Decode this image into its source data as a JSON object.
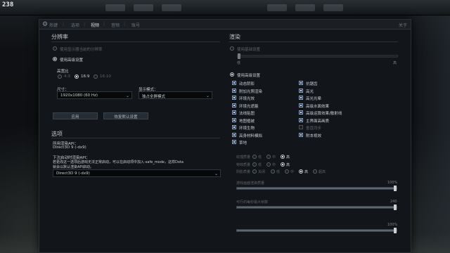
{
  "hud": {
    "fps": "238"
  },
  "tabs": [
    {
      "label": "热键"
    },
    {
      "label": "选项"
    },
    {
      "label": "视频"
    },
    {
      "label": "音频"
    },
    {
      "label": "账号"
    }
  ],
  "active_tab": "视频",
  "close_label": "关于",
  "resolution": {
    "title": "分辨率",
    "use_desktop_label": "使用显示器当前的分辨率",
    "use_advanced_label": "使用高级设置",
    "aspect_title": "高宽比",
    "aspect_options": [
      {
        "label": "4:3",
        "selected": false
      },
      {
        "label": "16:9",
        "selected": true
      },
      {
        "label": "16:10",
        "selected": false
      }
    ],
    "size_label": "尺寸：",
    "size_value": "1920x1080 (60 Hz)",
    "display_mode_label": "显示模式：",
    "display_mode_value": "独占全屏模式",
    "apply_button": "应用",
    "reset_button": "恢复默认设置"
  },
  "options": {
    "title": "选项",
    "api_label": "所用渲染API：",
    "api_value": "Direct3D 9 (-dx9)",
    "next_api_label": "下次启动时渲染API：",
    "warning_line1": "若更改这一选项后游戏无法正常启动，可以在启动项中加入-safe_mode，这样Dota",
    "warning_line2": "就会以默认渲染API启动。",
    "api_select_value": "Direct3D 9 (-dx9)"
  },
  "rendering": {
    "title": "渲染",
    "use_basic_label": "使用基础设置",
    "basic_slider_left": "低",
    "basic_slider_right": "高",
    "use_advanced_label": "使用高级设置",
    "checkboxes_left": [
      {
        "label": "动态阴影",
        "checked": true
      },
      {
        "label": "附加光照渲染",
        "checked": true
      },
      {
        "label": "环境光效",
        "checked": true
      },
      {
        "label": "环境光遮蔽",
        "checked": true
      },
      {
        "label": "法线贴图",
        "checked": true
      },
      {
        "label": "地图植被",
        "checked": true
      },
      {
        "label": "环境生物",
        "checked": true
      },
      {
        "label": "高身材料模拟",
        "checked": true
      },
      {
        "label": "草地",
        "checked": true
      }
    ],
    "checkboxes_right": [
      {
        "label": "抗锯齿",
        "checked": true
      },
      {
        "label": "高光",
        "checked": true
      },
      {
        "label": "高光光晕",
        "checked": true
      },
      {
        "label": "高级水面效果",
        "checked": true
      },
      {
        "label": "高级运算效果/散射线",
        "checked": true
      },
      {
        "label": "主界面高画质",
        "checked": true
      },
      {
        "label": "垂直同步",
        "checked": false
      },
      {
        "label": "附本视效",
        "checked": true
      }
    ],
    "quality_rows": [
      {
        "label": "纹理质量",
        "options": [
          "低",
          "中",
          "高"
        ],
        "selected": 2
      },
      {
        "label": "特效质量",
        "options": [
          "低",
          "中",
          "高"
        ],
        "selected": 2
      },
      {
        "label": "阴影质量",
        "options": [
          "关闭",
          "低",
          "中",
          "高",
          "超高"
        ],
        "selected": 3
      }
    ],
    "render_quality": {
      "label": "游戏画面渲染质量",
      "value_text": "100%",
      "value": 1.0
    },
    "max_fps": {
      "label": "可行的每秒最大帧数",
      "value_text": "240",
      "value": 1.0
    },
    "extra_slider": {
      "label": "",
      "value_text": "100%",
      "value": 1.0
    }
  }
}
